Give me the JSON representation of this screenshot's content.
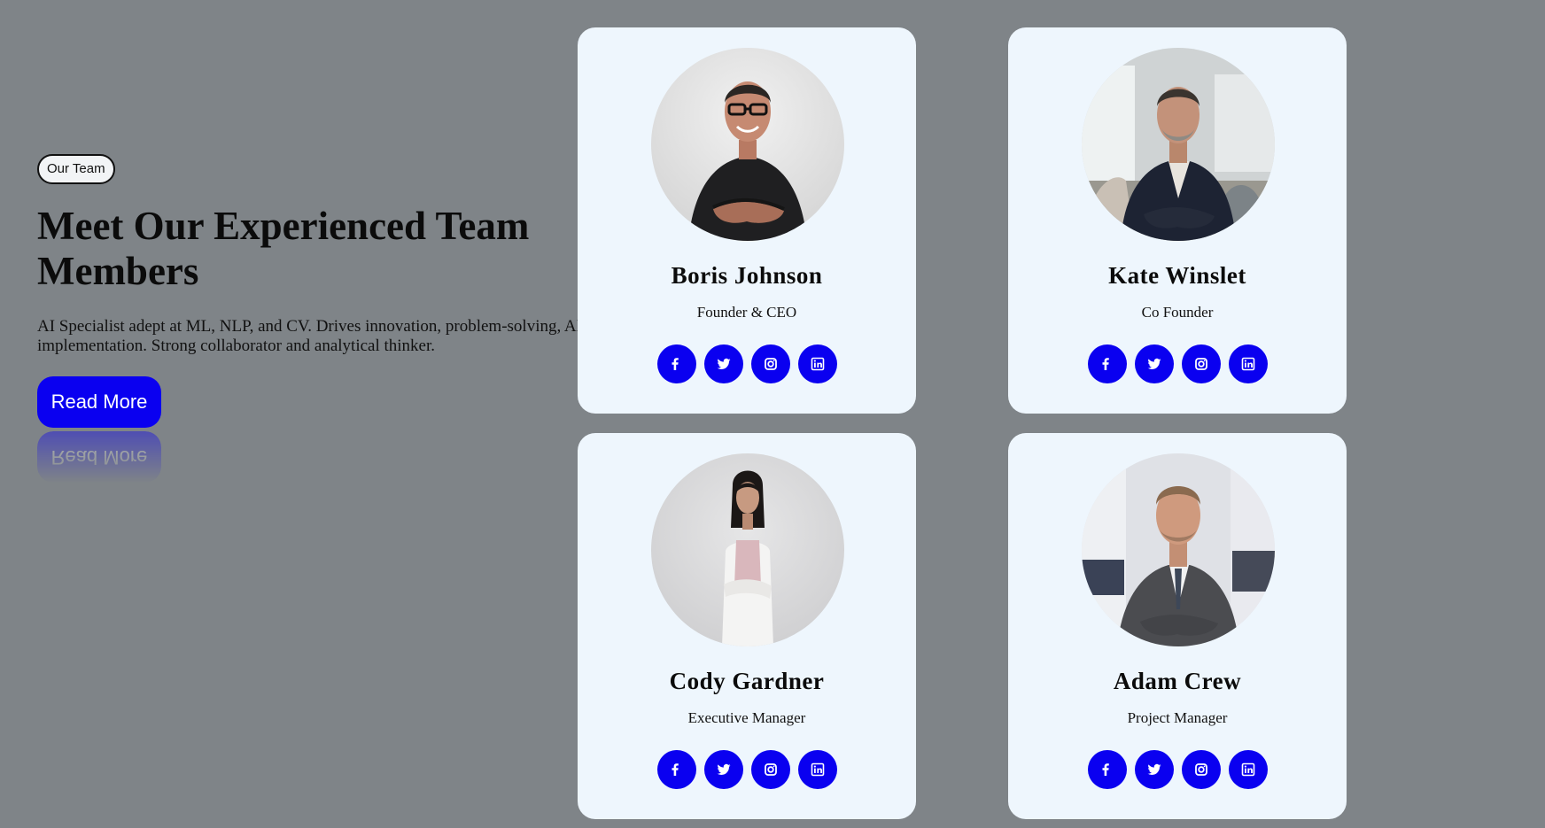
{
  "intro": {
    "badge": "Our Team",
    "heading": "Meet Our Experienced Team Members",
    "description": "AI Specialist adept at ML, NLP, and CV. Drives innovation, problem-solving, AI implementation. Strong collaborator and analytical thinker.",
    "button_label": "Read More"
  },
  "colors": {
    "background": "#7f8488",
    "card": "#eef6fd",
    "accent": "#0a00f0"
  },
  "members": [
    {
      "name": "Boris Johnson",
      "role": "Founder & CEO",
      "photo": "man-black-shirt-glasses-photo"
    },
    {
      "name": "Kate Winslet",
      "role": "Co Founder",
      "photo": "man-navy-blazer-office-photo"
    },
    {
      "name": "Cody Gardner",
      "role": "Executive Manager",
      "photo": "woman-white-suit-photo"
    },
    {
      "name": "Adam Crew",
      "role": "Project Manager",
      "photo": "man-grey-suit-office-photo"
    }
  ],
  "social_icons": [
    "facebook-icon",
    "twitter-icon",
    "instagram-icon",
    "linkedin-icon"
  ]
}
